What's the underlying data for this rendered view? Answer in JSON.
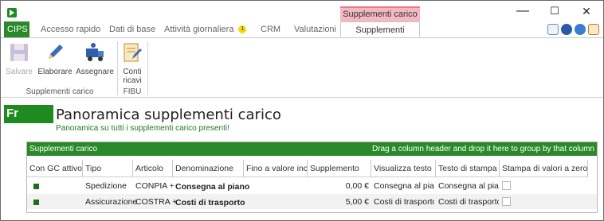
{
  "window": {
    "context_group": "Supplementi carico",
    "controls": {
      "minimize": "—",
      "maximize": "☐",
      "close": "✕"
    }
  },
  "tabs": [
    {
      "label": "CIPS"
    },
    {
      "label": "Accesso rapido"
    },
    {
      "label": "Dati di base"
    },
    {
      "label": "Attività giornaliera",
      "badge": "1"
    },
    {
      "label": "CRM"
    },
    {
      "label": "Valutazioni"
    },
    {
      "label": "Supplementi carico"
    }
  ],
  "ribbon": {
    "group1": {
      "label": "Supplementi carico",
      "buttons": [
        {
          "label": "Salvare",
          "icon": "floppy-disk-icon",
          "enabled": false
        },
        {
          "label": "Elaborare",
          "icon": "pencil-icon",
          "enabled": true
        },
        {
          "label": "Assegnare",
          "icon": "truck-person-icon",
          "enabled": true
        }
      ]
    },
    "group2": {
      "label": "FIBU",
      "buttons": [
        {
          "label": "Conti\nricavi",
          "line1": "Conti",
          "line2": "ricavi",
          "icon": "ledger-edit-icon"
        }
      ]
    }
  },
  "page": {
    "logo": "Fr",
    "title": "Panoramica supplementi carico",
    "subtitle": "Panoramica su tutti i supplementi carico presenti!"
  },
  "grid": {
    "title": "Supplementi carico",
    "group_hint": "Drag a column header and drop it here to group by that column",
    "columns": [
      "Con GC attivo",
      "Tipo",
      "Articolo",
      "Denominazione",
      "Fino a valore inc",
      "Supplemento",
      "Visualizza testo",
      "Testo di stampa",
      "Stampa di valori a zero"
    ],
    "rows": [
      {
        "active": true,
        "tipo": "Spedizione",
        "articolo": "CONPIA +",
        "denominazione": "Consegna al piano",
        "fino": "",
        "supplemento": "0,00 €",
        "visualizza": "Consegna al pian",
        "stampa": "Consegna al pian",
        "zero": false
      },
      {
        "active": true,
        "tipo": "Assicurazione",
        "articolo": "COSTRA +",
        "denominazione": "Costi di trasporto",
        "fino": "",
        "supplemento": "5,00 €",
        "visualizza": "Costi di trasporto",
        "stampa": "Costi di trasporto",
        "zero": false
      }
    ]
  },
  "colors": {
    "accent_green": "#2a8a2a",
    "context_pink": "#f4b8c0",
    "badge_yellow": "#f5d90a"
  }
}
